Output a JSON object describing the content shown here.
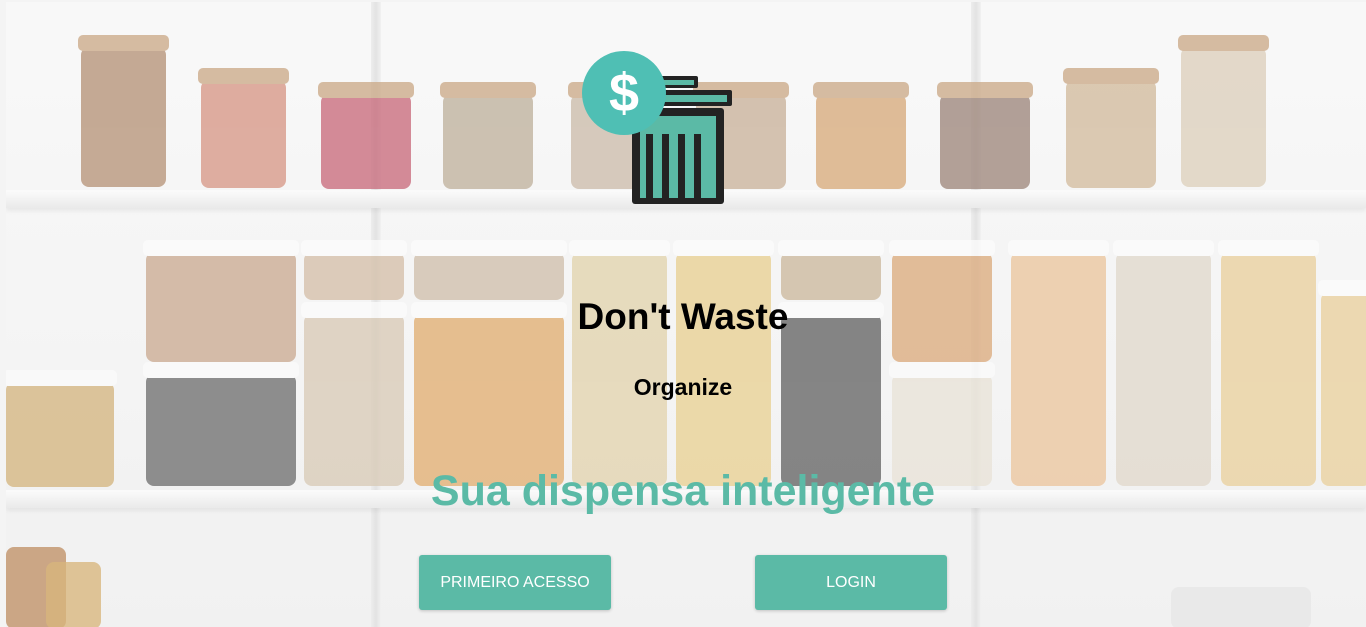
{
  "app": {
    "title": "Don't Waste",
    "subtitle": "Organize",
    "tagline": "Sua dispensa inteligente"
  },
  "buttons": {
    "first_access": "PRIMEIRO ACESSO",
    "login": "LOGIN"
  },
  "logo": {
    "symbol": "$",
    "icon": "trash-can-dollar-icon"
  },
  "colors": {
    "accent": "#5bbaa6",
    "dark": "#232323",
    "text": "#000000"
  }
}
